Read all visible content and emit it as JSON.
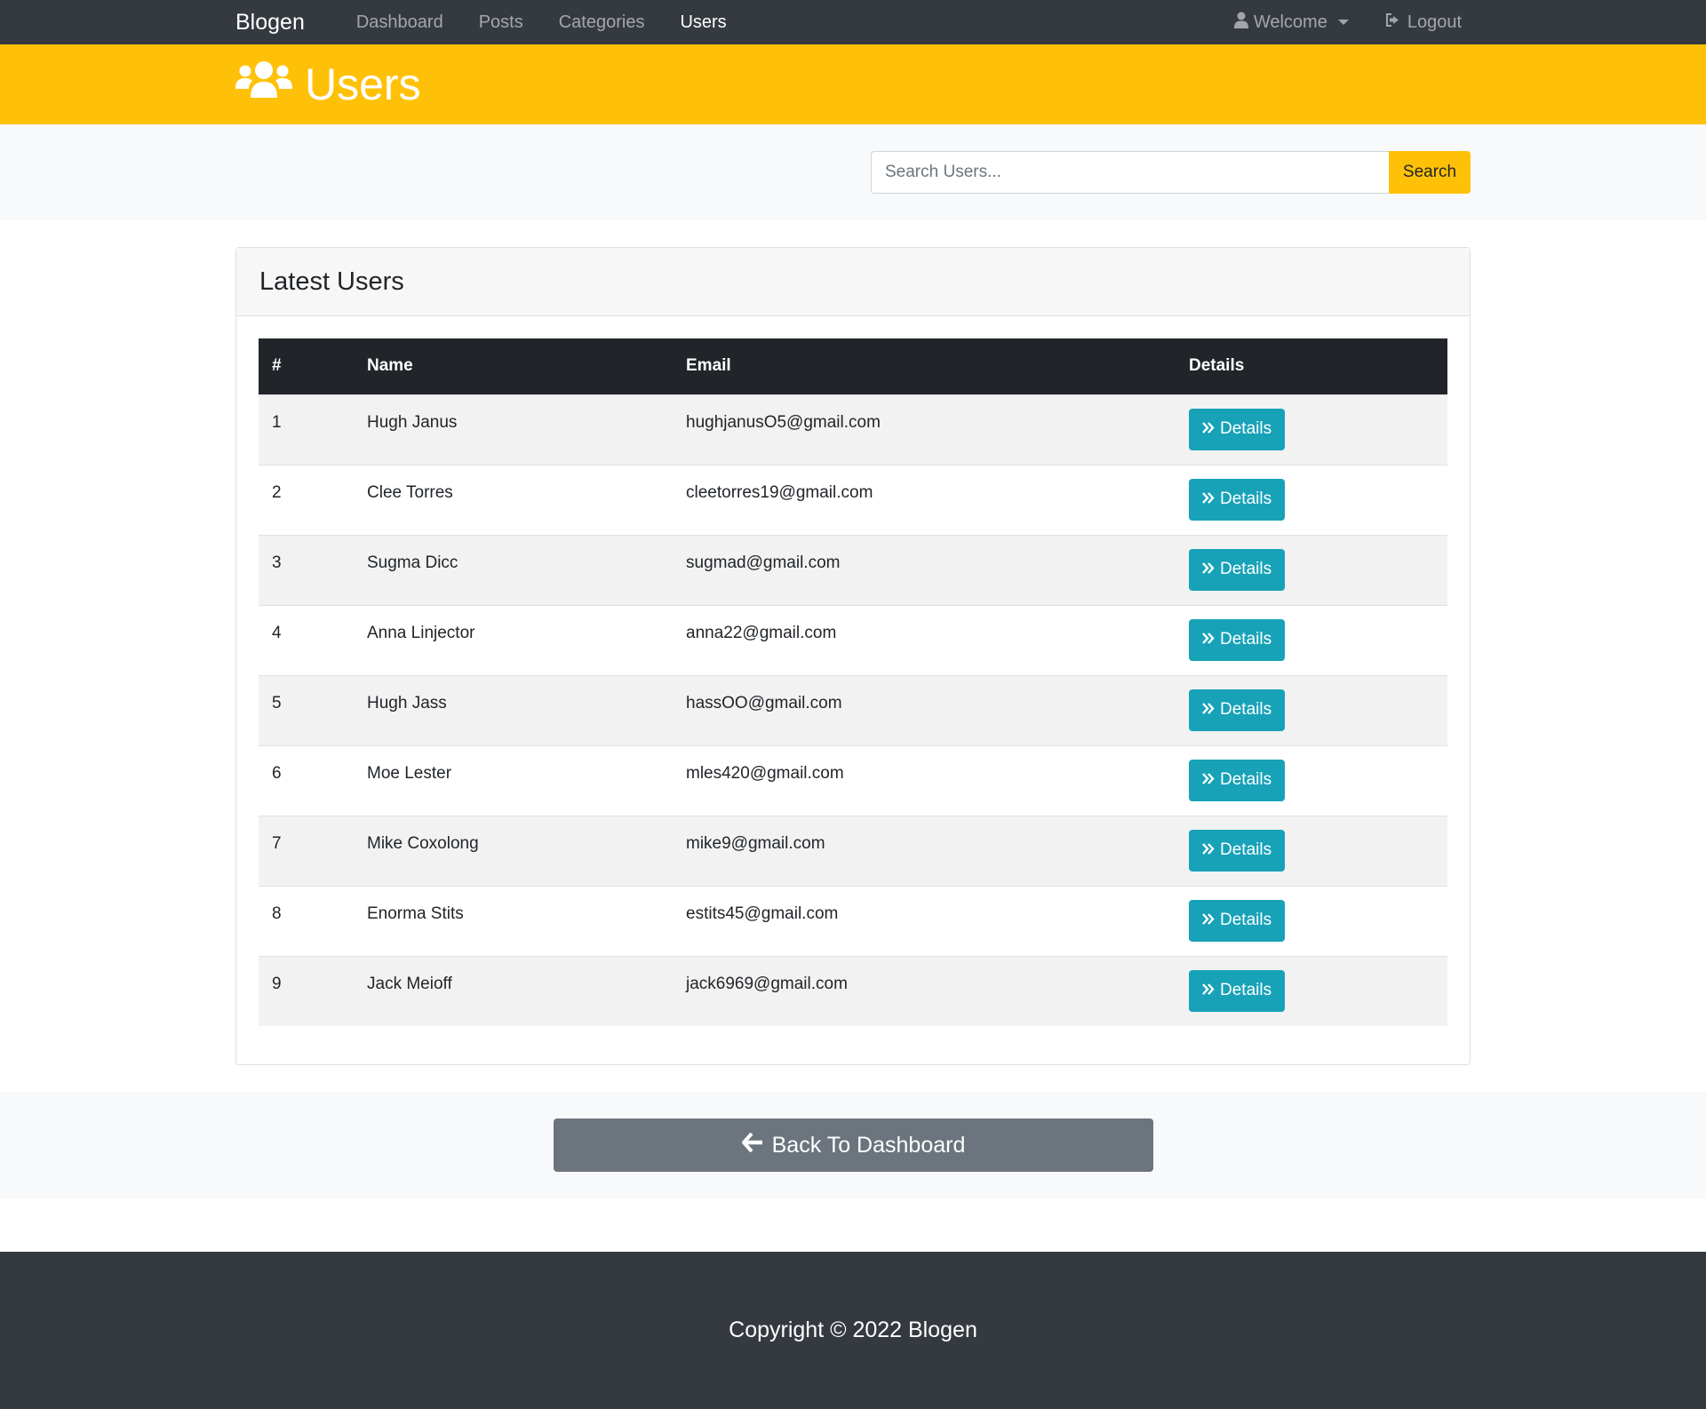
{
  "navbar": {
    "brand": "Blogen",
    "links": [
      {
        "label": "Dashboard"
      },
      {
        "label": "Posts"
      },
      {
        "label": "Categories"
      },
      {
        "label": "Users"
      }
    ],
    "welcome": "Welcome",
    "logout": "Logout"
  },
  "header": {
    "title": "Users",
    "icon": "users-icon"
  },
  "search": {
    "placeholder": "Search Users...",
    "button": "Search"
  },
  "card": {
    "title": "Latest Users",
    "columns": [
      "#",
      "Name",
      "Email",
      "Details"
    ],
    "rows": [
      {
        "num": "1",
        "name": "Hugh Janus",
        "email": "hughjanusO5@gmail.com",
        "action": "Details"
      },
      {
        "num": "2",
        "name": "Clee Torres",
        "email": "cleetorres19@gmail.com",
        "action": "Details"
      },
      {
        "num": "3",
        "name": "Sugma Dicc",
        "email": "sugmad@gmail.com",
        "action": "Details"
      },
      {
        "num": "4",
        "name": "Anna Linjector",
        "email": "anna22@gmail.com",
        "action": "Details"
      },
      {
        "num": "5",
        "name": "Hugh Jass",
        "email": "hassOO@gmail.com",
        "action": "Details"
      },
      {
        "num": "6",
        "name": "Moe Lester",
        "email": "mles420@gmail.com",
        "action": "Details"
      },
      {
        "num": "7",
        "name": "Mike Coxolong",
        "email": "mike9@gmail.com",
        "action": "Details"
      },
      {
        "num": "8",
        "name": "Enorma Stits",
        "email": "estits45@gmail.com",
        "action": "Details"
      },
      {
        "num": "9",
        "name": "Jack Meioff",
        "email": "jack6969@gmail.com",
        "action": "Details"
      }
    ]
  },
  "back": {
    "label": "Back To Dashboard"
  },
  "footer": {
    "copyright": "Copyright © 2022 Blogen"
  },
  "colors": {
    "navbar": "#343a40",
    "header": "#ffc107",
    "details_button": "#17a2b8",
    "back_button": "#6c757d"
  }
}
